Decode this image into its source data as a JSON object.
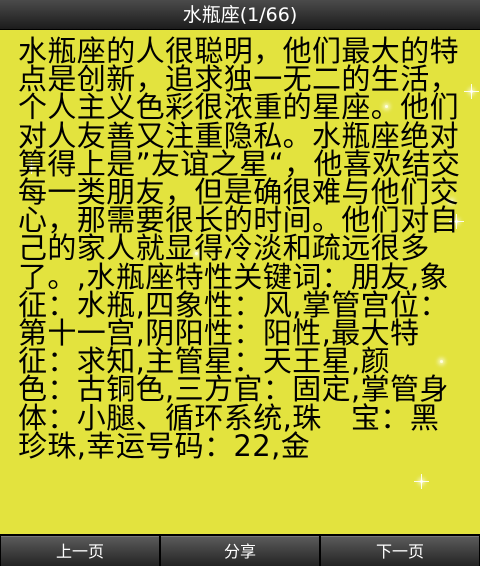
{
  "header": {
    "title": "水瓶座(1/66)"
  },
  "article": {
    "body": "水瓶座的人很聪明，他们最大的特点是创新，追求独一无二的生活，个人主义色彩很浓重的星座。他们对人友善又注重隐私。水瓶座绝对算得上是”友谊之星“，他喜欢结交每一类朋友，但是确很难与他们交心，那需要很长的时间。他们对自己的家人就显得冷淡和疏远很多了。,水瓶座特性关键词：朋友,象　征：水瓶,四象性：风,掌管宫位：第十一宫,阴阳性：阳性,最大特征：求知,主管星：天王星,颜　色：古铜色,三方官：固定,掌管身体：小腿、循环系统,珠　宝：黑珍珠,幸运号码：22,金"
  },
  "footer": {
    "prev_label": "上一页",
    "share_label": "分享",
    "next_label": "下一页"
  },
  "colors": {
    "content_background": "#e3e33e",
    "text": "#000000",
    "bar_background": "#2b2b2b"
  }
}
